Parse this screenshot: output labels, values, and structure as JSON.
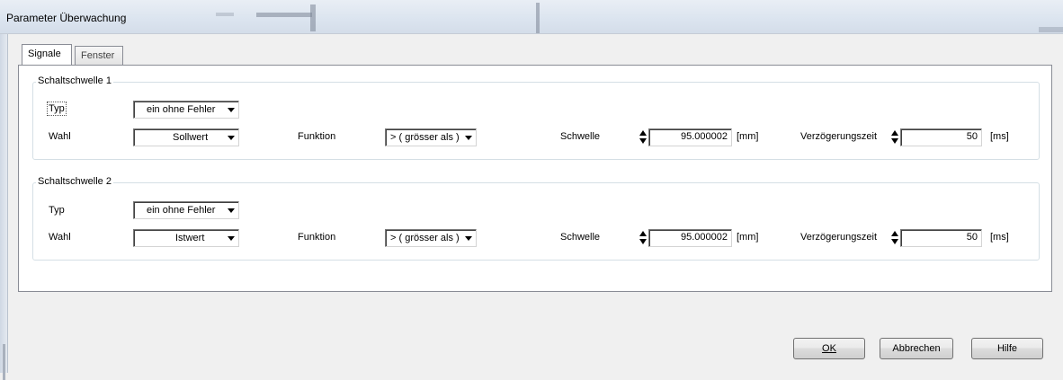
{
  "window": {
    "title": "Parameter Überwachung"
  },
  "tabs": [
    {
      "label": "Signale",
      "active": true
    },
    {
      "label": "Fenster",
      "active": false
    }
  ],
  "groups": [
    {
      "legend": "Schaltschwelle 1",
      "typ_label": "Typ",
      "typ_value": "ein ohne Fehler",
      "wahl_label": "Wahl",
      "wahl_value": "Sollwert",
      "funktion_label": "Funktion",
      "funktion_value": "> ( grösser als )",
      "schwelle_label": "Schwelle",
      "schwelle_value": "95.000002",
      "schwelle_unit": "[mm]",
      "verz_label": "Verzögerungszeit",
      "verz_value": "50",
      "verz_unit": "[ms]"
    },
    {
      "legend": "Schaltschwelle 2",
      "typ_label": "Typ",
      "typ_value": "ein ohne Fehler",
      "wahl_label": "Wahl",
      "wahl_value": "Istwert",
      "funktion_label": "Funktion",
      "funktion_value": "> ( grösser als )",
      "schwelle_label": "Schwelle",
      "schwelle_value": "95.000002",
      "schwelle_unit": "[mm]",
      "verz_label": "Verzögerungszeit",
      "verz_value": "50",
      "verz_unit": "[ms]"
    }
  ],
  "buttons": {
    "ok": "OK",
    "cancel": "Abbrechen",
    "help": "Hilfe"
  },
  "icons": {
    "spin": "spin-updown-icon",
    "dropdown": "chevron-down-icon"
  }
}
